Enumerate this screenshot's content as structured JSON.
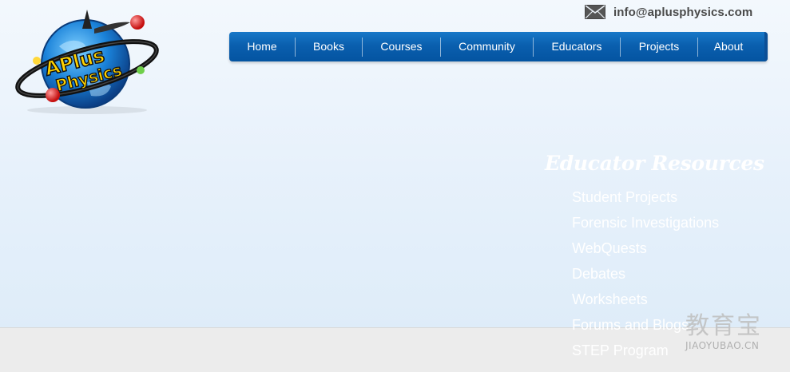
{
  "header": {
    "logo_alt": "APlus Physics.com",
    "email": "info@aplusphysics.com"
  },
  "nav": {
    "items": [
      {
        "label": "Home"
      },
      {
        "label": "Books"
      },
      {
        "label": "Courses"
      },
      {
        "label": "Community"
      },
      {
        "label": "Educators"
      },
      {
        "label": "Projects"
      },
      {
        "label": "About"
      }
    ]
  },
  "resources": {
    "title": "Educator Resources",
    "links": [
      "Student Projects",
      "Forensic Investigations",
      "WebQuests",
      "Debates",
      "Worksheets",
      "Forums and Blogs",
      "STEP Program"
    ]
  },
  "watermark": {
    "cn": "教育宝",
    "en": "JIAOYUBAO.CN"
  },
  "colors": {
    "nav_blue": "#0a5fae",
    "accent_red": "#e02020",
    "logo_yellow": "#ffd200"
  }
}
